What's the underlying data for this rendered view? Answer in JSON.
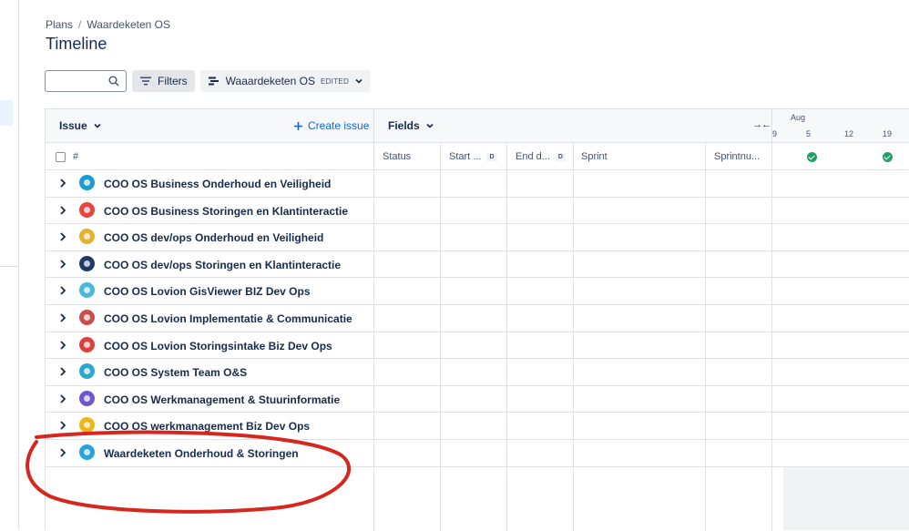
{
  "breadcrumb": {
    "root": "Plans",
    "separator": "/",
    "current": "Waardeketen OS"
  },
  "page_title": "Timeline",
  "toolbar": {
    "search_placeholder": "",
    "filters_label": "Filters",
    "view_label": "Waaardeketen OS",
    "view_badge": "EDITED"
  },
  "grid": {
    "issue_header": "Issue",
    "create_issue": "Create issue",
    "fields_header": "Fields",
    "collapse_glyph": "→←",
    "month": "Aug",
    "days": [
      "9",
      "5",
      "12",
      "19"
    ],
    "hash": "#",
    "columns": {
      "status": "Status",
      "start": "Start ...",
      "start_badge": "D",
      "end": "End d...",
      "end_badge": "D",
      "sprint": "Sprint",
      "sprintnum": "Sprintnu..."
    }
  },
  "rows": [
    {
      "label": "COO OS Business Onderhoud en Veiligheid",
      "avatar_color": "#1d9bd1"
    },
    {
      "label": "COO OS Business Storingen en Klantinteractie",
      "avatar_color": "#e2483d"
    },
    {
      "label": "COO OS dev/ops Onderhoud en Veiligheid",
      "avatar_color": "#e5b12e"
    },
    {
      "label": "COO OS dev/ops Storingen en Klantinteractie",
      "avatar_color": "#1f3a68"
    },
    {
      "label": "COO OS Lovion GisViewer BIZ Dev Ops",
      "avatar_color": "#4cb8d9"
    },
    {
      "label": "COO OS Lovion Implementatie & Communicatie",
      "avatar_color": "#c94f4f"
    },
    {
      "label": "COO OS Lovion Storingsintake Biz Dev Ops",
      "avatar_color": "#d7443e"
    },
    {
      "label": "COO OS System Team O&S",
      "avatar_color": "#2aa7d3"
    },
    {
      "label": "COO OS Werkmanagement & Stuurinformatie",
      "avatar_color": "#6f55d2"
    },
    {
      "label": "COO OS werkmanagement Biz Dev Ops",
      "avatar_color": "#f1b51c"
    },
    {
      "label": "Waardeketen Onderhoud & Storingen",
      "avatar_color": "#29a3d8"
    }
  ],
  "colors": {
    "accent": "#0c66e4",
    "success": "#22a06b",
    "annotation": "#d7261e"
  }
}
